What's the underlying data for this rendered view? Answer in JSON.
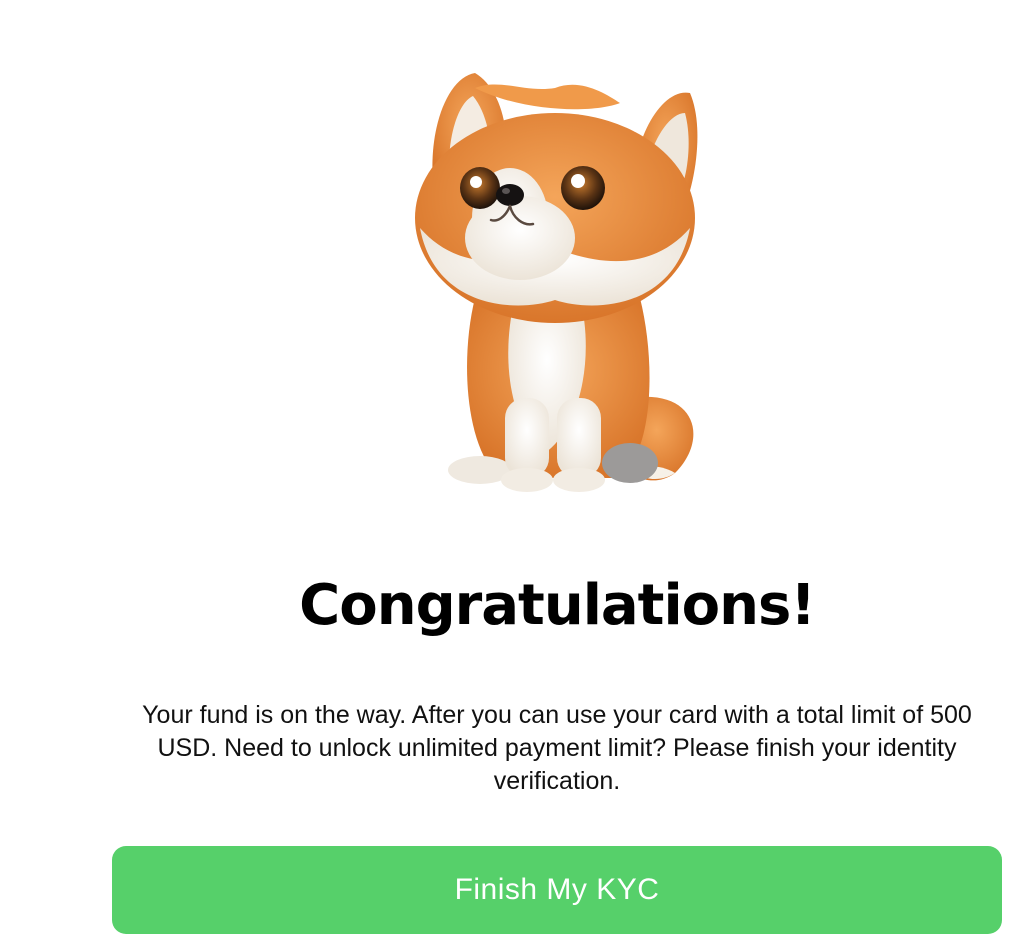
{
  "mascot": {
    "icon": "fox-mascot-icon"
  },
  "congrats": {
    "title": "Congratulations!",
    "message": "Your fund is on the way. After you can use your card with a total limit of 500 USD. Need to unlock unlimited payment limit? Please finish your identity verification."
  },
  "actions": {
    "finish_kyc_label": "Finish My KYC"
  },
  "colors": {
    "accent": "#56d06a",
    "fox_orange": "#e8893a",
    "fox_cream": "#f7f1e8"
  }
}
